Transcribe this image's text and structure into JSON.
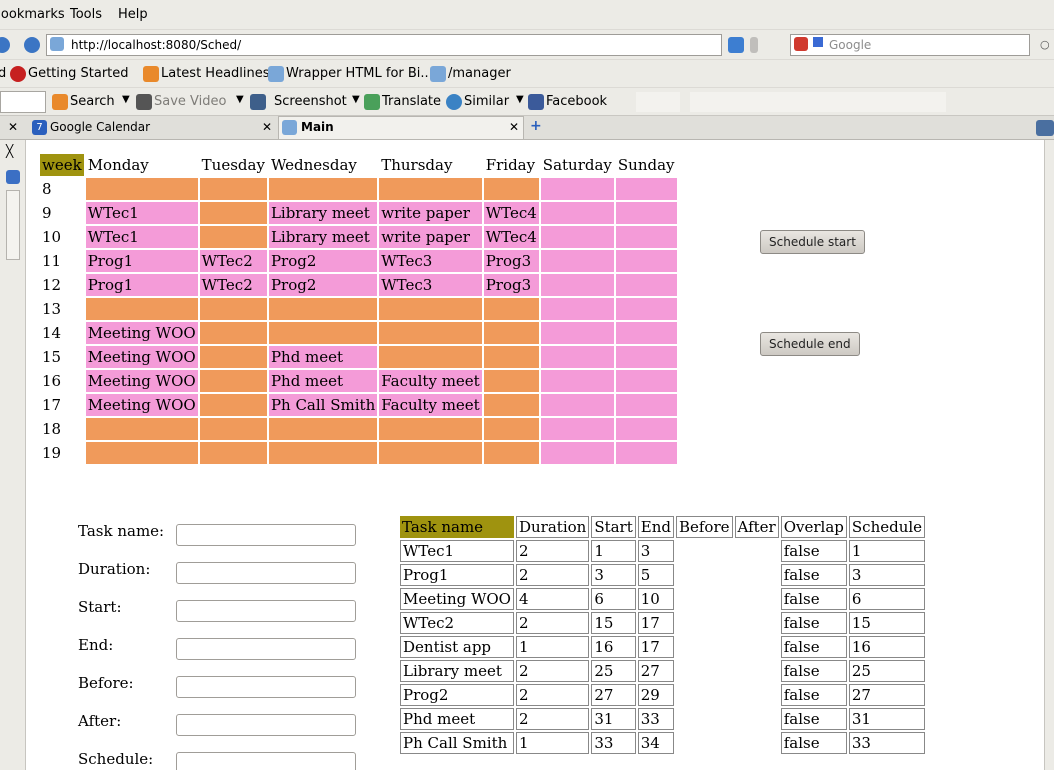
{
  "menu": {
    "items": [
      "Bookmarks",
      "Tools",
      "Help"
    ]
  },
  "nav": {
    "url": "http://localhost:8080/Sched/",
    "search_placeholder": "Google"
  },
  "bookmarks": {
    "items": [
      "Getting Started",
      "Latest Headlines",
      "Wrapper HTML for Bi...",
      "/manager"
    ]
  },
  "toolbar": {
    "search": "Search",
    "save_video": "Save Video",
    "screenshot": "Screenshot",
    "translate": "Translate",
    "similar": "Similar",
    "facebook": "Facebook"
  },
  "tabs": [
    {
      "label": "Google Calendar",
      "icon_text": "7"
    },
    {
      "label": "Main"
    }
  ],
  "colors": {
    "busy": "#f09a5b",
    "free": "#f49bd8",
    "header": "#9f930f"
  },
  "calendar": {
    "week_label": "week",
    "days": [
      "Monday",
      "Tuesday",
      "Wednesday",
      "Thursday",
      "Friday",
      "Saturday",
      "Sunday"
    ],
    "rows": [
      {
        "hour": "8",
        "cells": [
          {
            "t": "",
            "c": "o"
          },
          {
            "t": "",
            "c": "o"
          },
          {
            "t": "",
            "c": "o"
          },
          {
            "t": "",
            "c": "o"
          },
          {
            "t": "",
            "c": "o"
          },
          {
            "t": "",
            "c": "p"
          },
          {
            "t": "",
            "c": "p"
          }
        ]
      },
      {
        "hour": "9",
        "cells": [
          {
            "t": "WTec1",
            "c": "p"
          },
          {
            "t": "",
            "c": "o"
          },
          {
            "t": "Library meet",
            "c": "p"
          },
          {
            "t": "write paper",
            "c": "p"
          },
          {
            "t": "WTec4",
            "c": "p"
          },
          {
            "t": "",
            "c": "p"
          },
          {
            "t": "",
            "c": "p"
          }
        ]
      },
      {
        "hour": "10",
        "cells": [
          {
            "t": "WTec1",
            "c": "p"
          },
          {
            "t": "",
            "c": "o"
          },
          {
            "t": "Library meet",
            "c": "p"
          },
          {
            "t": "write paper",
            "c": "p"
          },
          {
            "t": "WTec4",
            "c": "p"
          },
          {
            "t": "",
            "c": "p"
          },
          {
            "t": "",
            "c": "p"
          }
        ]
      },
      {
        "hour": "11",
        "cells": [
          {
            "t": "Prog1",
            "c": "p"
          },
          {
            "t": "WTec2",
            "c": "p"
          },
          {
            "t": "Prog2",
            "c": "p"
          },
          {
            "t": "WTec3",
            "c": "p"
          },
          {
            "t": "Prog3",
            "c": "p"
          },
          {
            "t": "",
            "c": "p"
          },
          {
            "t": "",
            "c": "p"
          }
        ]
      },
      {
        "hour": "12",
        "cells": [
          {
            "t": "Prog1",
            "c": "p"
          },
          {
            "t": "WTec2",
            "c": "p"
          },
          {
            "t": "Prog2",
            "c": "p"
          },
          {
            "t": "WTec3",
            "c": "p"
          },
          {
            "t": "Prog3",
            "c": "p"
          },
          {
            "t": "",
            "c": "p"
          },
          {
            "t": "",
            "c": "p"
          }
        ]
      },
      {
        "hour": "13",
        "cells": [
          {
            "t": "",
            "c": "o"
          },
          {
            "t": "",
            "c": "o"
          },
          {
            "t": "",
            "c": "o"
          },
          {
            "t": "",
            "c": "o"
          },
          {
            "t": "",
            "c": "o"
          },
          {
            "t": "",
            "c": "p"
          },
          {
            "t": "",
            "c": "p"
          }
        ]
      },
      {
        "hour": "14",
        "cells": [
          {
            "t": "Meeting WOO",
            "c": "p"
          },
          {
            "t": "",
            "c": "o"
          },
          {
            "t": "",
            "c": "o"
          },
          {
            "t": "",
            "c": "o"
          },
          {
            "t": "",
            "c": "o"
          },
          {
            "t": "",
            "c": "p"
          },
          {
            "t": "",
            "c": "p"
          }
        ]
      },
      {
        "hour": "15",
        "cells": [
          {
            "t": "Meeting WOO",
            "c": "p"
          },
          {
            "t": "",
            "c": "o"
          },
          {
            "t": "Phd meet",
            "c": "p"
          },
          {
            "t": "",
            "c": "o"
          },
          {
            "t": "",
            "c": "o"
          },
          {
            "t": "",
            "c": "p"
          },
          {
            "t": "",
            "c": "p"
          }
        ]
      },
      {
        "hour": "16",
        "cells": [
          {
            "t": "Meeting WOO",
            "c": "p"
          },
          {
            "t": "",
            "c": "o"
          },
          {
            "t": "Phd meet",
            "c": "p"
          },
          {
            "t": "Faculty meet",
            "c": "p"
          },
          {
            "t": "",
            "c": "o"
          },
          {
            "t": "",
            "c": "p"
          },
          {
            "t": "",
            "c": "p"
          }
        ]
      },
      {
        "hour": "17",
        "cells": [
          {
            "t": "Meeting WOO",
            "c": "p"
          },
          {
            "t": "",
            "c": "o"
          },
          {
            "t": "Ph Call Smith",
            "c": "p"
          },
          {
            "t": "Faculty meet",
            "c": "p"
          },
          {
            "t": "",
            "c": "o"
          },
          {
            "t": "",
            "c": "p"
          },
          {
            "t": "",
            "c": "p"
          }
        ]
      },
      {
        "hour": "18",
        "cells": [
          {
            "t": "",
            "c": "o"
          },
          {
            "t": "",
            "c": "o"
          },
          {
            "t": "",
            "c": "o"
          },
          {
            "t": "",
            "c": "o"
          },
          {
            "t": "",
            "c": "o"
          },
          {
            "t": "",
            "c": "p"
          },
          {
            "t": "",
            "c": "p"
          }
        ]
      },
      {
        "hour": "19",
        "cells": [
          {
            "t": "",
            "c": "o"
          },
          {
            "t": "",
            "c": "o"
          },
          {
            "t": "",
            "c": "o"
          },
          {
            "t": "",
            "c": "o"
          },
          {
            "t": "",
            "c": "o"
          },
          {
            "t": "",
            "c": "p"
          },
          {
            "t": "",
            "c": "p"
          }
        ]
      }
    ]
  },
  "buttons": {
    "schedule_start": "Schedule start",
    "schedule_end": "Schedule end"
  },
  "form": {
    "labels": [
      "Task name:",
      "Duration:",
      "Start:",
      "End:",
      "Before:",
      "After:",
      "Schedule:"
    ]
  },
  "tasks": {
    "headers": [
      "Task name",
      "Duration",
      "Start",
      "End",
      "Before",
      "After",
      "Overlap",
      "Schedule"
    ],
    "rows": [
      [
        "WTec1",
        "2",
        "1",
        "3",
        "",
        "",
        "false",
        "1"
      ],
      [
        "Prog1",
        "2",
        "3",
        "5",
        "",
        "",
        "false",
        "3"
      ],
      [
        "Meeting WOO",
        "4",
        "6",
        "10",
        "",
        "",
        "false",
        "6"
      ],
      [
        "WTec2",
        "2",
        "15",
        "17",
        "",
        "",
        "false",
        "15"
      ],
      [
        "Dentist app",
        "1",
        "16",
        "17",
        "",
        "",
        "false",
        "16"
      ],
      [
        "Library meet",
        "2",
        "25",
        "27",
        "",
        "",
        "false",
        "25"
      ],
      [
        "Prog2",
        "2",
        "27",
        "29",
        "",
        "",
        "false",
        "27"
      ],
      [
        "Phd meet",
        "2",
        "31",
        "33",
        "",
        "",
        "false",
        "31"
      ],
      [
        "Ph Call Smith",
        "1",
        "33",
        "34",
        "",
        "",
        "false",
        "33"
      ]
    ]
  }
}
